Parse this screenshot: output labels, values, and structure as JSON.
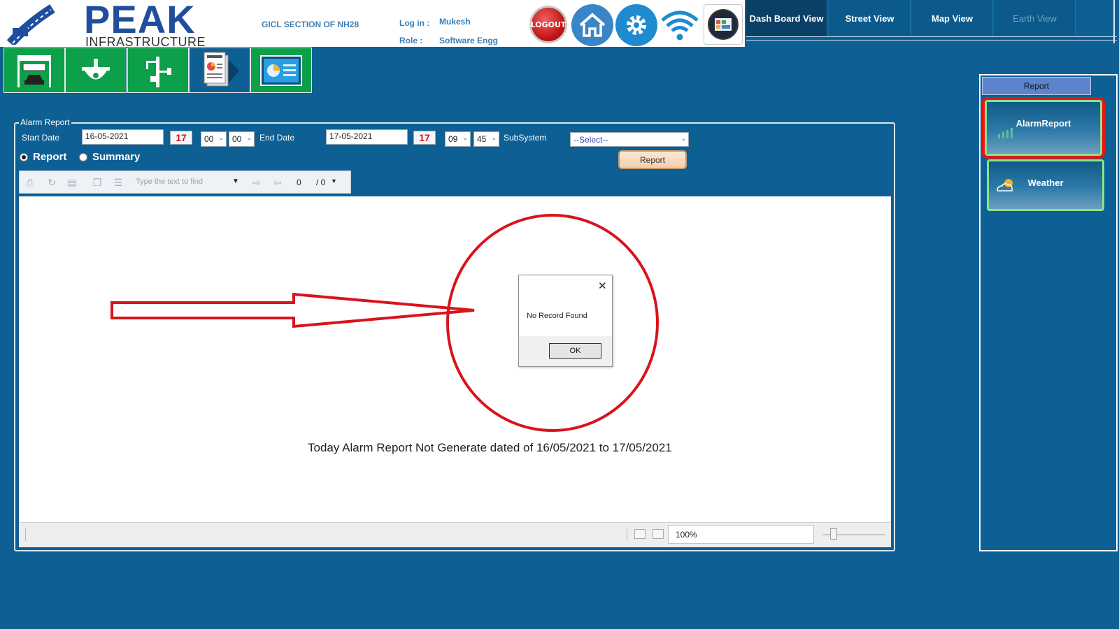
{
  "header": {
    "logo_word": "PEAK",
    "logo_subtitle": "INFRASTRUCTURE",
    "section_title": "GICL SECTION OF NH28",
    "login_label": "Log in :",
    "login_value": "Mukesh",
    "role_label": "Role   :",
    "role_value": "Software Engg",
    "logout_label": "LOGOUT",
    "icons": [
      "logout-icon",
      "home-icon",
      "gear-icon",
      "wifi-icon",
      "apps-icon"
    ]
  },
  "nav_tabs": [
    {
      "label": "Dash Board View",
      "active": true
    },
    {
      "label": "Street View",
      "active": false
    },
    {
      "label": "Map View",
      "active": false
    },
    {
      "label": "Earth View",
      "active": false,
      "disabled": true
    }
  ],
  "toolbar_icons": [
    "toll-booth-icon",
    "dome-camera-icon",
    "weather-station-icon",
    "report-document-icon",
    "dashboard-chart-icon"
  ],
  "alarm_report": {
    "legend": "Alarm Report",
    "start_label": "Start Date",
    "start_date": "16-05-2021",
    "calendar_day": "17",
    "start_hour": "00",
    "start_minute": "00",
    "end_label": "End Date",
    "end_date": "17-05-2021",
    "end_hour": "09",
    "end_minute": "45",
    "subsystem_label": "SubSystem",
    "subsystem_value": "--Select--",
    "radio_report": "Report",
    "radio_summary": "Summary",
    "selected_mode": "Report",
    "report_button": "Report"
  },
  "viewer": {
    "find_placeholder": "Type the text to find",
    "page_current": "0",
    "page_total": "/ 0",
    "empty_message": "Today Alarm Report Not Generate dated of 16/05/2021 to 17/05/2021",
    "zoom": "100%"
  },
  "dialog": {
    "message": "No Record Found",
    "ok_label": "OK"
  },
  "side_panel": {
    "title": "Report",
    "items": [
      {
        "label": "AlarmReport",
        "selected": true
      },
      {
        "label": "Weather",
        "selected": false
      }
    ]
  },
  "colors": {
    "background": "#0d5f94",
    "green_button": "#0da04a",
    "annotation_red": "#d8141c",
    "selected_outline": "#e21818"
  }
}
